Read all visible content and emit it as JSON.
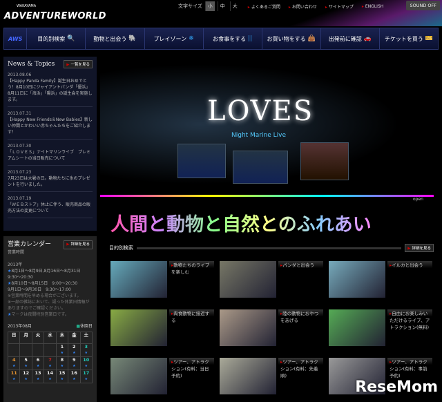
{
  "header": {
    "logo_small": "WAKAYAMA",
    "logo": "ADVENTUREWORLD",
    "text_size_label": "文字サイズ",
    "sizes": [
      "小",
      "中",
      "大"
    ],
    "links": [
      "よくあるご質問",
      "お問い合わせ",
      "サイトマップ",
      "ENGLISH"
    ],
    "sound": "SOUND OFF"
  },
  "nav": {
    "logo": "AWS",
    "items": [
      {
        "label": "目的別検索",
        "icon": "🔍"
      },
      {
        "label": "動物と出会う",
        "icon": "🐘"
      },
      {
        "label": "プレイゾーン",
        "icon": "❄"
      },
      {
        "label": "お食事をする",
        "icon": "||"
      },
      {
        "label": "お買い物をする",
        "icon": "👜"
      },
      {
        "label": "出発前に確認",
        "icon": "🚗"
      },
      {
        "label": "チケットを買う",
        "icon": "🎫"
      }
    ]
  },
  "news": {
    "title": "News & Topics",
    "more": "一覧を見る",
    "items": [
      {
        "date": "2013.08.06",
        "text": "【Happy Panda Family】誕生日おめでとう！8月10日にジャイアントパンダ「優浜」8月11日に「海浜」「陽浜」の誕生会を実施します。"
      },
      {
        "date": "2013.07.31",
        "text": "【Happy New Friends＆New Babies】新しい仲間とかわいい赤ちゃんたちをご紹介します！"
      },
      {
        "date": "2013.07.30",
        "text": "「ＬＯＶＥＳ」ナイトマリンライブ　プレミアムシートの当日販売について"
      },
      {
        "date": "2013.07.23",
        "text": "7月23日は大暑の日。動物たちに氷のプレゼントを行いました。"
      },
      {
        "date": "2013.07.19",
        "text": "「ＷＥＢストア」休止に伴う、販売商品の販売方法の変更について"
      }
    ]
  },
  "calendar": {
    "title": "営業カレンダー",
    "more": "詳細を見る",
    "hours_label": "営業時間",
    "year": "2013年",
    "lines": [
      "8月1日～8月9日,8月16日～8月31日　9:30～20:30",
      "8月10日～8月15日　9:00～20:30",
      "9月1日～9月30日　9:30～17:00"
    ],
    "notes": [
      "※営業時間を早める場合がございます。",
      "※一部の雑誌において、誤った休業日情報がありますのでご確認ください。",
      "マークは夜間特別営業日です。"
    ],
    "month": "2013年08月",
    "holiday": "休園日",
    "weekdays": [
      "日",
      "月",
      "火",
      "水",
      "木",
      "金",
      "土"
    ],
    "weeks": [
      [
        "",
        "",
        "",
        "",
        "1",
        "2",
        "3"
      ],
      [
        "4",
        "5",
        "6",
        "7",
        "8",
        "9",
        "10"
      ],
      [
        "11",
        "12",
        "13",
        "14",
        "15",
        "16",
        "17"
      ]
    ],
    "star": "★"
  },
  "hero": {
    "title": "LOVES",
    "subtitle": "Night Marine  Live",
    "open": "open"
  },
  "tagline": "人間と動物と自然とのふれあい",
  "search": {
    "title": "目的別検索",
    "more": "詳細を見る",
    "cards": [
      "動物たちのライブを楽しむ",
      "パンダと出会う",
      "イルカと出会う",
      "肉食動物に接近する",
      "陸の動物におやつをあげる",
      "自由にお楽しみいただけるライブ、アトラクション(無料)",
      "ツアー、アトラクション(有料：当日予約)",
      "ツアー、アトラクション(有料：先着順)",
      "ツアー、アトラクション(有料：事前予約)"
    ]
  },
  "watermark": "ReseMom"
}
